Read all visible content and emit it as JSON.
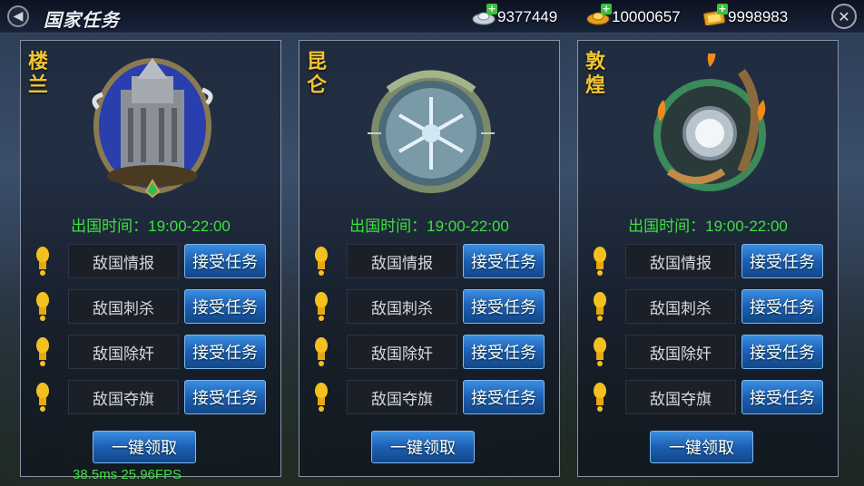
{
  "header": {
    "title": "国家任务",
    "currencies": [
      {
        "icon": "silver-ingot-icon",
        "value": "9377449"
      },
      {
        "icon": "gold-ingot-icon",
        "value": "10000657"
      },
      {
        "icon": "gold-ticket-icon",
        "value": "9998983"
      }
    ]
  },
  "panels": [
    {
      "country": "楼兰",
      "emblem": "fortress-emblem",
      "time": "出国时间：19:00-22:00",
      "missions": [
        {
          "label": "敌国情报",
          "button": "接受任务"
        },
        {
          "label": "敌国刺杀",
          "button": "接受任务"
        },
        {
          "label": "敌国除奸",
          "button": "接受任务"
        },
        {
          "label": "敌国夺旗",
          "button": "接受任务"
        }
      ],
      "claim": "一键领取"
    },
    {
      "country": "昆仑",
      "emblem": "snowflake-emblem",
      "time": "出国时间：19:00-22:00",
      "missions": [
        {
          "label": "敌国情报",
          "button": "接受任务"
        },
        {
          "label": "敌国刺杀",
          "button": "接受任务"
        },
        {
          "label": "敌国除奸",
          "button": "接受任务"
        },
        {
          "label": "敌国夺旗",
          "button": "接受任务"
        }
      ],
      "claim": "一键领取"
    },
    {
      "country": "敦煌",
      "emblem": "flying-apsara-emblem",
      "time": "出国时间：19:00-22:00",
      "missions": [
        {
          "label": "敌国情报",
          "button": "接受任务"
        },
        {
          "label": "敌国刺杀",
          "button": "接受任务"
        },
        {
          "label": "敌国除奸",
          "button": "接受任务"
        },
        {
          "label": "敌国夺旗",
          "button": "接受任务"
        }
      ],
      "claim": "一键领取"
    }
  ],
  "debug": {
    "fps_text": "38.5ms 25.96FPS"
  }
}
